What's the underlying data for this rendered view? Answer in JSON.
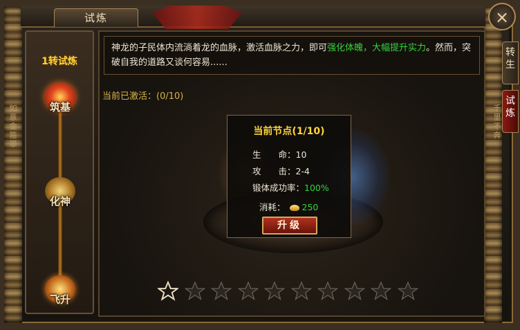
{
  "window": {
    "title": "试炼",
    "close_icon": "×"
  },
  "sidebar": {
    "title": "1转试炼",
    "nodes": [
      {
        "label": "筑基",
        "state": "active"
      },
      {
        "label": "化神",
        "state": "locked"
      },
      {
        "label": "飞升",
        "state": "locked"
      }
    ]
  },
  "right_tabs": [
    {
      "chars": [
        "转",
        "生"
      ],
      "selected": false
    },
    {
      "chars": [
        "试",
        "炼"
      ],
      "selected": true
    }
  ],
  "side_text": {
    "left": "如意金箍翠",
    "right": "千里不奔"
  },
  "description": {
    "part1": "神龙的子民体内流淌着龙的血脉，激活血脉之力，即可",
    "highlight": "强化体魄，大幅提升实力",
    "part2": "。然而，突破自我的道路又谈何容易......"
  },
  "activated_text": "当前已激活：(0/10)",
  "node_popup": {
    "title": "当前节点(1/10)",
    "stats": [
      {
        "key": "生　　命：",
        "value": "10"
      },
      {
        "key": "攻　　击：",
        "value": "2-4"
      },
      {
        "key": "锻体成功率：",
        "value": "100%"
      }
    ],
    "cost_label": "消耗：",
    "cost_value": "250",
    "upgrade_label": "升级"
  },
  "stars": {
    "total": 10,
    "filled": 1
  },
  "colors": {
    "accent_gold": "#ffd43a",
    "highlight_green": "#34d43a",
    "button_red": "#b0321e"
  }
}
